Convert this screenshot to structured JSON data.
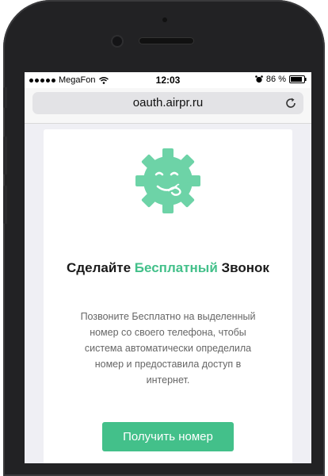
{
  "status_bar": {
    "carrier": "MegaFon",
    "time": "12:03",
    "battery": "86 %",
    "icons": [
      "signal-dots-icon",
      "wifi-icon",
      "alarm-icon",
      "battery-icon"
    ]
  },
  "browser": {
    "url": "oauth.airpr.ru",
    "reload_icon": "reload-icon"
  },
  "card": {
    "logo_icon": "gear-smile-icon",
    "headline": {
      "part1": "Сделайте ",
      "accent": "Бесплатный",
      "part2": " Звонок"
    },
    "description": "Позвоните Бесплатно на выделенный номер со своего телефона, чтобы система автоматически определила номер и предоставила доступ в интернет.",
    "button_label": "Получить номер"
  },
  "colors": {
    "accent": "#43c08a",
    "logo_fill": "#6dd3a7"
  }
}
